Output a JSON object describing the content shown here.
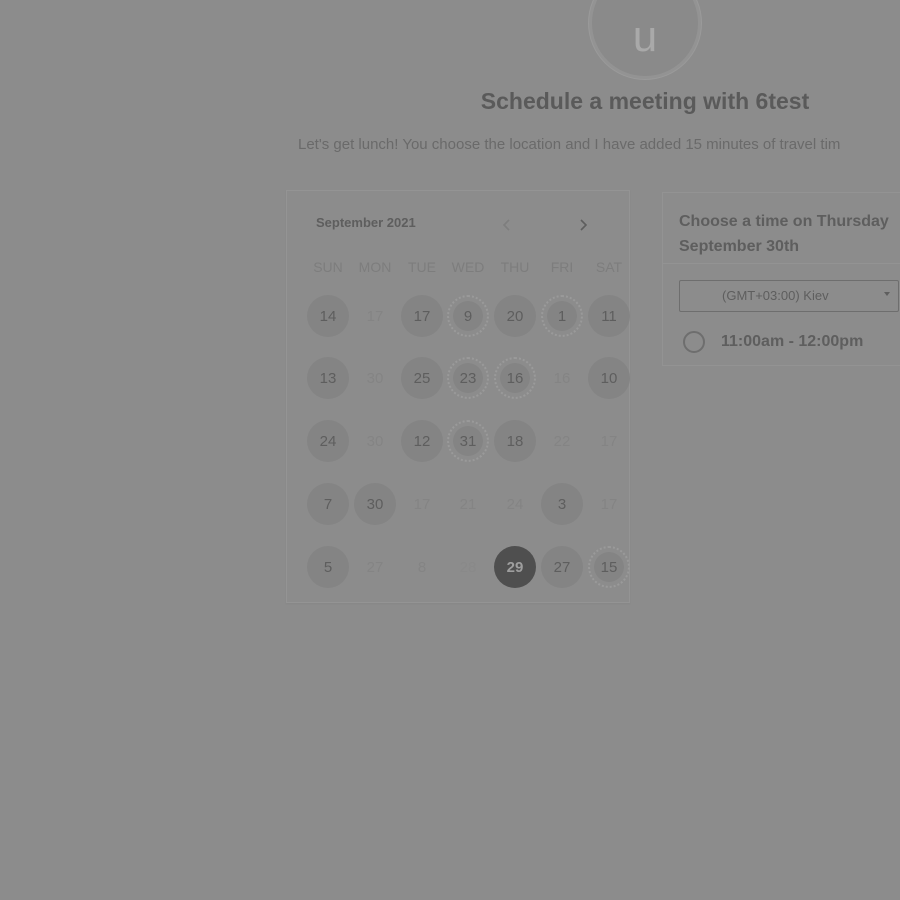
{
  "header": {
    "avatar_initial": "u",
    "title": "Schedule a meeting with 6test",
    "subtitle": "Let's get lunch! You choose the location and I have added 15 minutes of travel tim"
  },
  "calendar": {
    "month_label": "September 2021",
    "prev_icon": "chevron-left-icon",
    "next_icon": "chevron-right-icon",
    "weekdays": [
      "SUN",
      "MON",
      "TUE",
      "WED",
      "THU",
      "FRI",
      "SAT"
    ],
    "weeks": [
      [
        {
          "label": "14",
          "state": "avail"
        },
        {
          "label": "17",
          "state": "muted"
        },
        {
          "label": "17",
          "state": "avail"
        },
        {
          "label": "9",
          "state": "dotted"
        },
        {
          "label": "20",
          "state": "avail"
        },
        {
          "label": "1",
          "state": "dotted"
        },
        {
          "label": "11",
          "state": "avail"
        }
      ],
      [
        {
          "label": "13",
          "state": "avail"
        },
        {
          "label": "30",
          "state": "muted"
        },
        {
          "label": "25",
          "state": "avail"
        },
        {
          "label": "23",
          "state": "dotted"
        },
        {
          "label": "16",
          "state": "dotted"
        },
        {
          "label": "16",
          "state": "muted"
        },
        {
          "label": "10",
          "state": "avail"
        }
      ],
      [
        {
          "label": "24",
          "state": "avail"
        },
        {
          "label": "30",
          "state": "muted"
        },
        {
          "label": "12",
          "state": "avail"
        },
        {
          "label": "31",
          "state": "dotted"
        },
        {
          "label": "18",
          "state": "avail"
        },
        {
          "label": "22",
          "state": "muted"
        },
        {
          "label": "17",
          "state": "muted"
        }
      ],
      [
        {
          "label": "7",
          "state": "avail"
        },
        {
          "label": "30",
          "state": "avail"
        },
        {
          "label": "17",
          "state": "muted"
        },
        {
          "label": "21",
          "state": "muted"
        },
        {
          "label": "24",
          "state": "muted"
        },
        {
          "label": "3",
          "state": "avail"
        },
        {
          "label": "17",
          "state": "muted"
        }
      ],
      [
        {
          "label": "5",
          "state": "avail"
        },
        {
          "label": "27",
          "state": "muted"
        },
        {
          "label": "8",
          "state": "muted"
        },
        {
          "label": "28",
          "state": "dim"
        },
        {
          "label": "29",
          "state": "selected"
        },
        {
          "label": "27",
          "state": "avail"
        },
        {
          "label": "15",
          "state": "dotted"
        }
      ]
    ]
  },
  "time_panel": {
    "heading_line1": "Choose a time on Thursday",
    "heading_line2": "September 30th",
    "timezone_value": "(GMT+03:00) Kiev",
    "slots": [
      {
        "label": "11:00am - 12:00pm"
      }
    ]
  }
}
